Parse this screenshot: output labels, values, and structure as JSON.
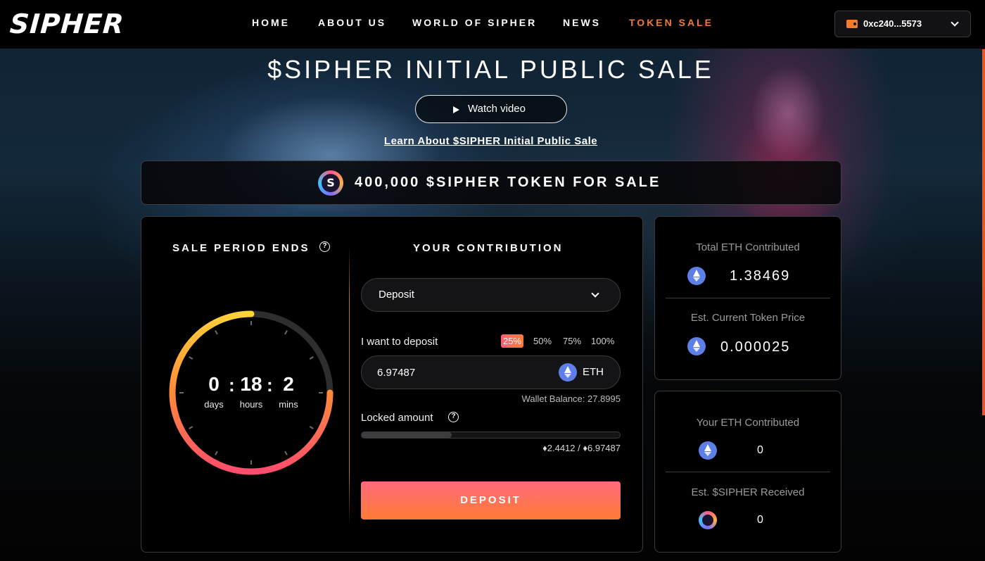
{
  "brand": {
    "logo_text": "SIPHER"
  },
  "nav": {
    "items": [
      {
        "label": "HOME"
      },
      {
        "label": "ABOUT US"
      },
      {
        "label": "WORLD OF SIPHER"
      },
      {
        "label": "NEWS"
      },
      {
        "label": "TOKEN SALE",
        "active": true
      }
    ],
    "wallet_address": "0xc240...5573"
  },
  "hero": {
    "title": "$SIPHER INITIAL PUBLIC SALE",
    "watch_label": "Watch video",
    "learn_link": "Learn About $SIPHER Initial Public Sale"
  },
  "banner": {
    "text": "400,000 $SIPHER TOKEN FOR SALE"
  },
  "timer": {
    "title": "SALE PERIOD ENDS",
    "days": "0",
    "days_label": "days",
    "hours": "18",
    "hours_label": "hours",
    "mins": "2",
    "mins_label": "mins",
    "remaining_fraction": 0.75
  },
  "contribution": {
    "title": "YOUR CONTRIBUTION",
    "mode_selected": "Deposit",
    "deposit_label": "I want to deposit",
    "percent_options": [
      "25%",
      "50%",
      "75%",
      "100%"
    ],
    "percent_active_index": 0,
    "amount_value": "6.97487",
    "currency": "ETH",
    "wallet_balance": "Wallet Balance: 27.8995",
    "locked_label": "Locked amount",
    "locked_current": "2.4412",
    "locked_total": "6.97487",
    "locked_fraction": 0.35,
    "deposit_button": "DEPOSIT"
  },
  "stats": {
    "total_eth_label": "Total ETH Contributed",
    "total_eth_value": "1.38469",
    "token_price_label": "Est. Current Token Price",
    "token_price_value": "0.000025",
    "your_eth_label": "Your ETH Contributed",
    "your_eth_value": "0",
    "sipher_received_label": "Est. $SIPHER Received",
    "sipher_received_value": "0"
  },
  "colors": {
    "accent_orange": "#f17a36",
    "button_gradient_start": "#ff6a7c",
    "button_gradient_end": "#ff7b35",
    "eth_blue": "#5f7fe8"
  }
}
